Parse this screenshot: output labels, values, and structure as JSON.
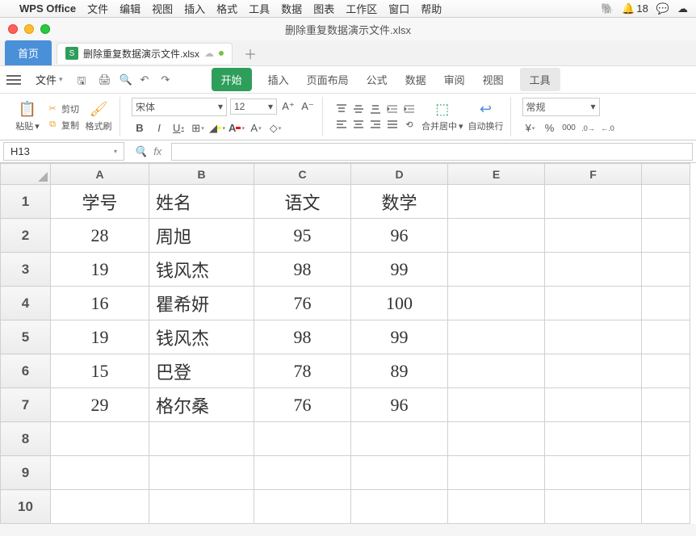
{
  "mac_menu": {
    "app": "WPS Office",
    "items": [
      "文件",
      "编辑",
      "视图",
      "插入",
      "格式",
      "工具",
      "数据",
      "图表",
      "工作区",
      "窗口",
      "帮助"
    ],
    "notif_count": "18"
  },
  "window": {
    "title": "删除重复数据演示文件.xlsx"
  },
  "tabs": {
    "home": "首页",
    "file": "删除重复数据演示文件.xlsx"
  },
  "ribbon_tabs": {
    "file": "文件",
    "list": [
      "开始",
      "插入",
      "页面布局",
      "公式",
      "数据",
      "审阅",
      "视图",
      "工具"
    ],
    "active_index": 0,
    "tool_index": 7
  },
  "ribbon": {
    "paste": "粘贴",
    "cut": "剪切",
    "copy": "复制",
    "format_painter": "格式刷",
    "font_name": "宋体",
    "font_size": "12",
    "merge": "合并居中",
    "wrap": "自动换行",
    "number_format": "常规"
  },
  "cellref": {
    "name": "H13",
    "formula": ""
  },
  "columns": [
    "A",
    "B",
    "C",
    "D",
    "E",
    "F"
  ],
  "row_count": 10,
  "chart_data": {
    "type": "table",
    "headers": [
      "学号",
      "姓名",
      "语文",
      "数学"
    ],
    "rows": [
      [
        "28",
        "周旭",
        "95",
        "96"
      ],
      [
        "19",
        "钱风杰",
        "98",
        "99"
      ],
      [
        "16",
        "瞿希妍",
        "76",
        "100"
      ],
      [
        "19",
        "钱风杰",
        "98",
        "99"
      ],
      [
        "15",
        "巴登",
        "78",
        "89"
      ],
      [
        "29",
        "格尔桑",
        "76",
        "96"
      ]
    ]
  }
}
